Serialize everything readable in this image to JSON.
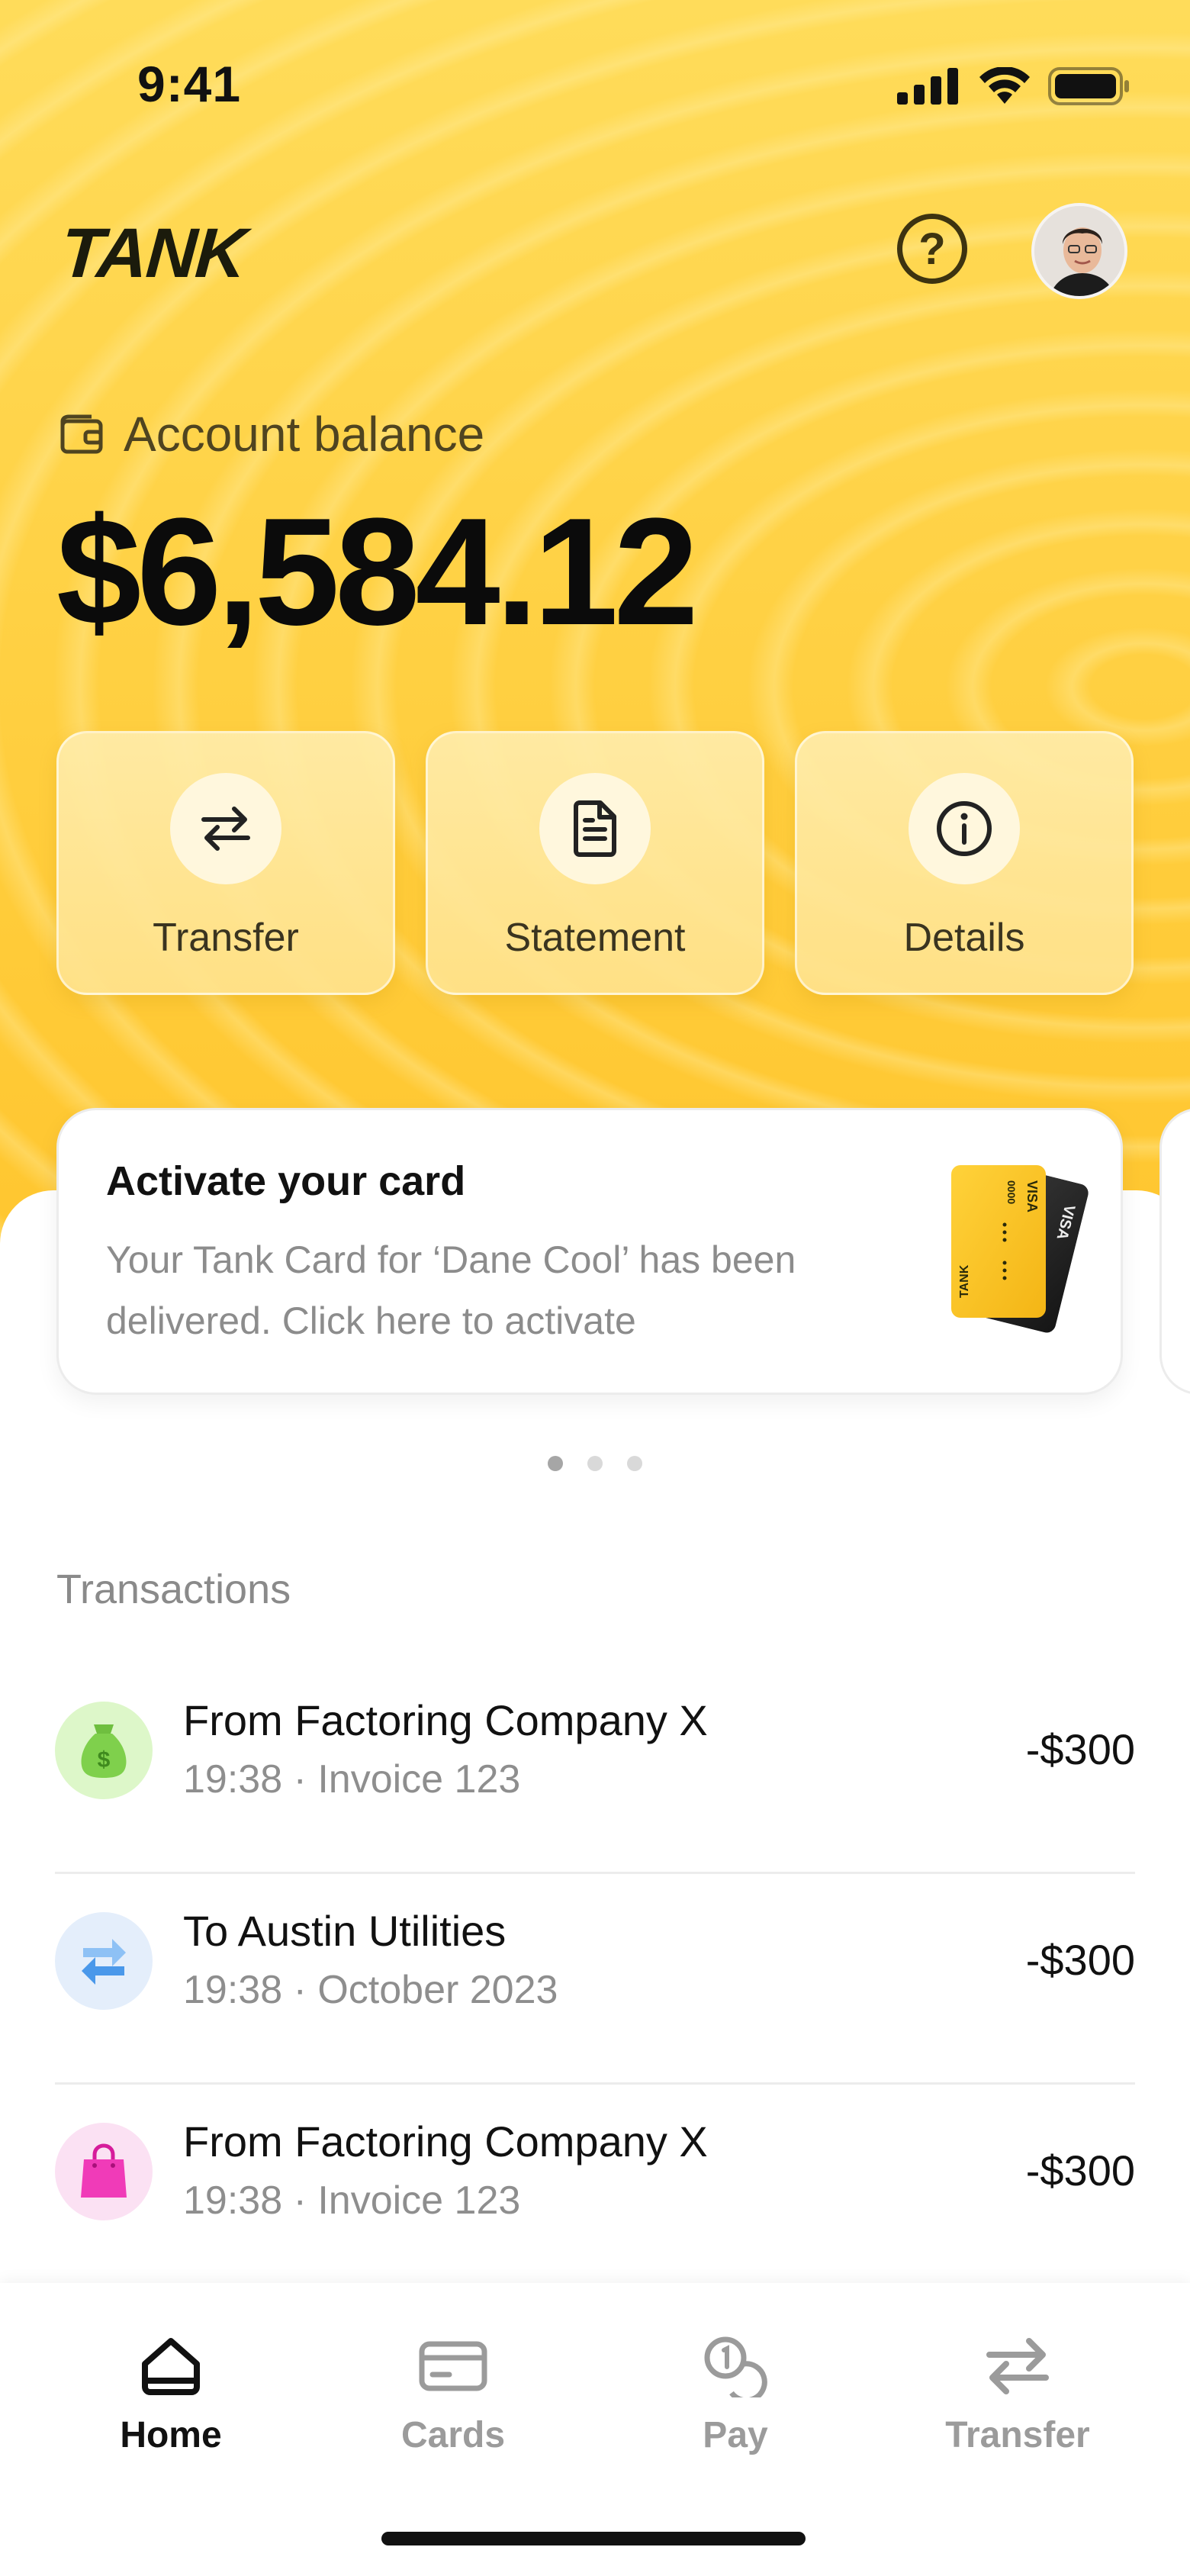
{
  "status_bar": {
    "time": "9:41"
  },
  "header": {
    "logo": "TANK",
    "help_icon": "question-circle-icon",
    "avatar_icon": "user-avatar"
  },
  "balance": {
    "label": "Account balance",
    "amount": "$6,584.12",
    "icon": "wallet-icon"
  },
  "actions": [
    {
      "label": "Transfer",
      "icon": "arrows-swap-icon"
    },
    {
      "label": "Statement",
      "icon": "document-icon"
    },
    {
      "label": "Details",
      "icon": "info-circle-icon"
    }
  ],
  "promo": {
    "title": "Activate your card",
    "text": "Your Tank Card for ‘Dane Cool’ has been delivered. Click here to activate",
    "card_brand": "VISA",
    "card_logo": "TANK",
    "card_digits": "0000",
    "pagination": {
      "count": 3,
      "active_index": 0
    }
  },
  "transactions": {
    "heading": "Transactions",
    "items": [
      {
        "title": "From Factoring Company X",
        "subtitle": "19:38 · Invoice 123",
        "amount": "-$300",
        "icon": "money-bag-icon",
        "icon_bg": "#DDF7C9"
      },
      {
        "title": "To Austin Utilities",
        "subtitle": "19:38 · October 2023",
        "amount": "-$300",
        "icon": "transfer-arrows-icon",
        "icon_bg": "#E4EEFB"
      },
      {
        "title": "From Factoring Company X",
        "subtitle": "19:38 · Invoice 123",
        "amount": "-$300",
        "icon": "shopping-bag-icon",
        "icon_bg": "#FBE1F3"
      }
    ]
  },
  "tabbar": {
    "items": [
      {
        "label": "Home",
        "icon": "home-icon",
        "active": true
      },
      {
        "label": "Cards",
        "icon": "card-icon",
        "active": false
      },
      {
        "label": "Pay",
        "icon": "coins-icon",
        "active": false
      },
      {
        "label": "Transfer",
        "icon": "arrows-swap-icon",
        "active": false
      }
    ]
  },
  "colors": {
    "brand_yellow": "#FFD44A",
    "text_dark": "#111111",
    "muted": "#8E8E8E"
  }
}
